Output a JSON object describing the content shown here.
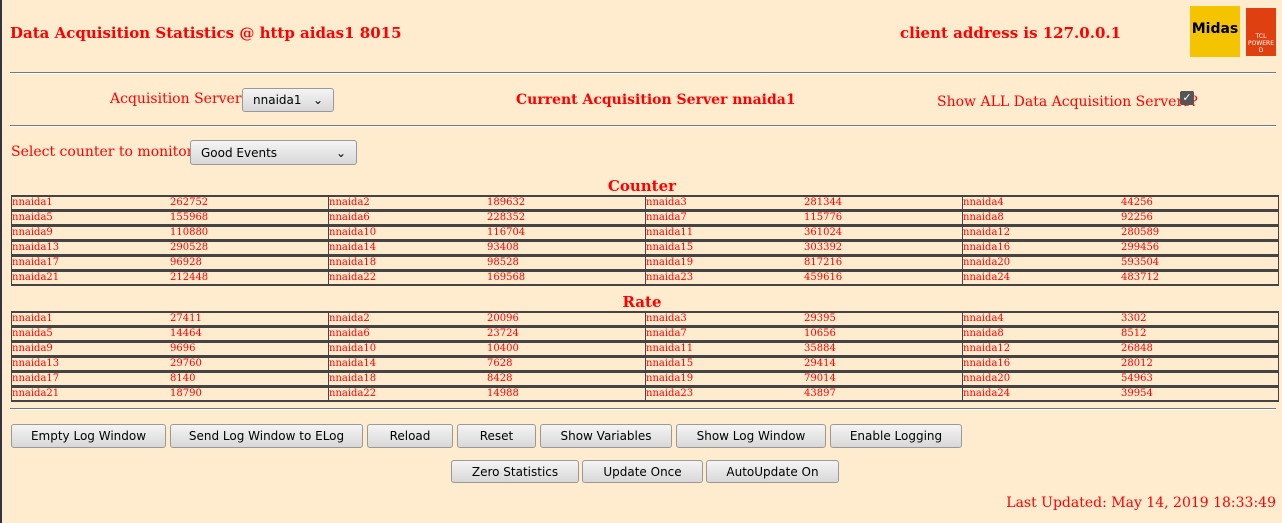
{
  "header": {
    "title": "Data Acquisition Statistics @ http aidas1 8015",
    "client": "client address is 127.0.0.1",
    "logo_text": "Midas",
    "logo2_text": "TCL POWERED"
  },
  "servers": {
    "label": "Acquisition Servers",
    "selected": "nnaida1",
    "current": "Current Acquisition Server nnaida1",
    "show_all_label": "Show ALL Data Acquisition Servers?",
    "show_all_checked": true
  },
  "counter_select": {
    "label": "Select counter to monitor",
    "selected": "Good Events"
  },
  "counter": {
    "title": "Counter",
    "rows": [
      [
        [
          "nnaida1",
          "262752"
        ],
        [
          "nnaida2",
          "189632"
        ],
        [
          "nnaida3",
          "281344"
        ],
        [
          "nnaida4",
          "44256"
        ]
      ],
      [
        [
          "nnaida5",
          "155968"
        ],
        [
          "nnaida6",
          "228352"
        ],
        [
          "nnaida7",
          "115776"
        ],
        [
          "nnaida8",
          "92256"
        ]
      ],
      [
        [
          "nnaida9",
          "110880"
        ],
        [
          "nnaida10",
          "116704"
        ],
        [
          "nnaida11",
          "361024"
        ],
        [
          "nnaida12",
          "280589"
        ]
      ],
      [
        [
          "nnaida13",
          "290528"
        ],
        [
          "nnaida14",
          "93408"
        ],
        [
          "nnaida15",
          "303392"
        ],
        [
          "nnaida16",
          "299456"
        ]
      ],
      [
        [
          "nnaida17",
          "96928"
        ],
        [
          "nnaida18",
          "98528"
        ],
        [
          "nnaida19",
          "817216"
        ],
        [
          "nnaida20",
          "593504"
        ]
      ],
      [
        [
          "nnaida21",
          "212448"
        ],
        [
          "nnaida22",
          "169568"
        ],
        [
          "nnaida23",
          "459616"
        ],
        [
          "nnaida24",
          "483712"
        ]
      ]
    ]
  },
  "rate": {
    "title": "Rate",
    "rows": [
      [
        [
          "nnaida1",
          "27411"
        ],
        [
          "nnaida2",
          "20096"
        ],
        [
          "nnaida3",
          "29395"
        ],
        [
          "nnaida4",
          "3302"
        ]
      ],
      [
        [
          "nnaida5",
          "14464"
        ],
        [
          "nnaida6",
          "23724"
        ],
        [
          "nnaida7",
          "10656"
        ],
        [
          "nnaida8",
          "8512"
        ]
      ],
      [
        [
          "nnaida9",
          "9696"
        ],
        [
          "nnaida10",
          "10400"
        ],
        [
          "nnaida11",
          "35884"
        ],
        [
          "nnaida12",
          "26848"
        ]
      ],
      [
        [
          "nnaida13",
          "29760"
        ],
        [
          "nnaida14",
          "7628"
        ],
        [
          "nnaida15",
          "29414"
        ],
        [
          "nnaida16",
          "28012"
        ]
      ],
      [
        [
          "nnaida17",
          "8140"
        ],
        [
          "nnaida18",
          "8428"
        ],
        [
          "nnaida19",
          "79014"
        ],
        [
          "nnaida20",
          "54963"
        ]
      ],
      [
        [
          "nnaida21",
          "18790"
        ],
        [
          "nnaida22",
          "14988"
        ],
        [
          "nnaida23",
          "43897"
        ],
        [
          "nnaida24",
          "39954"
        ]
      ]
    ]
  },
  "buttons": {
    "empty_log": "Empty Log Window",
    "send_elog": "Send Log Window to ELog",
    "reload": "Reload",
    "reset": "Reset",
    "show_vars": "Show Variables",
    "show_log": "Show Log Window",
    "enable_logging": "Enable Logging",
    "zero_stats": "Zero Statistics",
    "update_once": "Update Once",
    "autoupdate": "AutoUpdate On"
  },
  "footer": {
    "last_updated": "Last Updated: May 14, 2019 18:33:49"
  }
}
